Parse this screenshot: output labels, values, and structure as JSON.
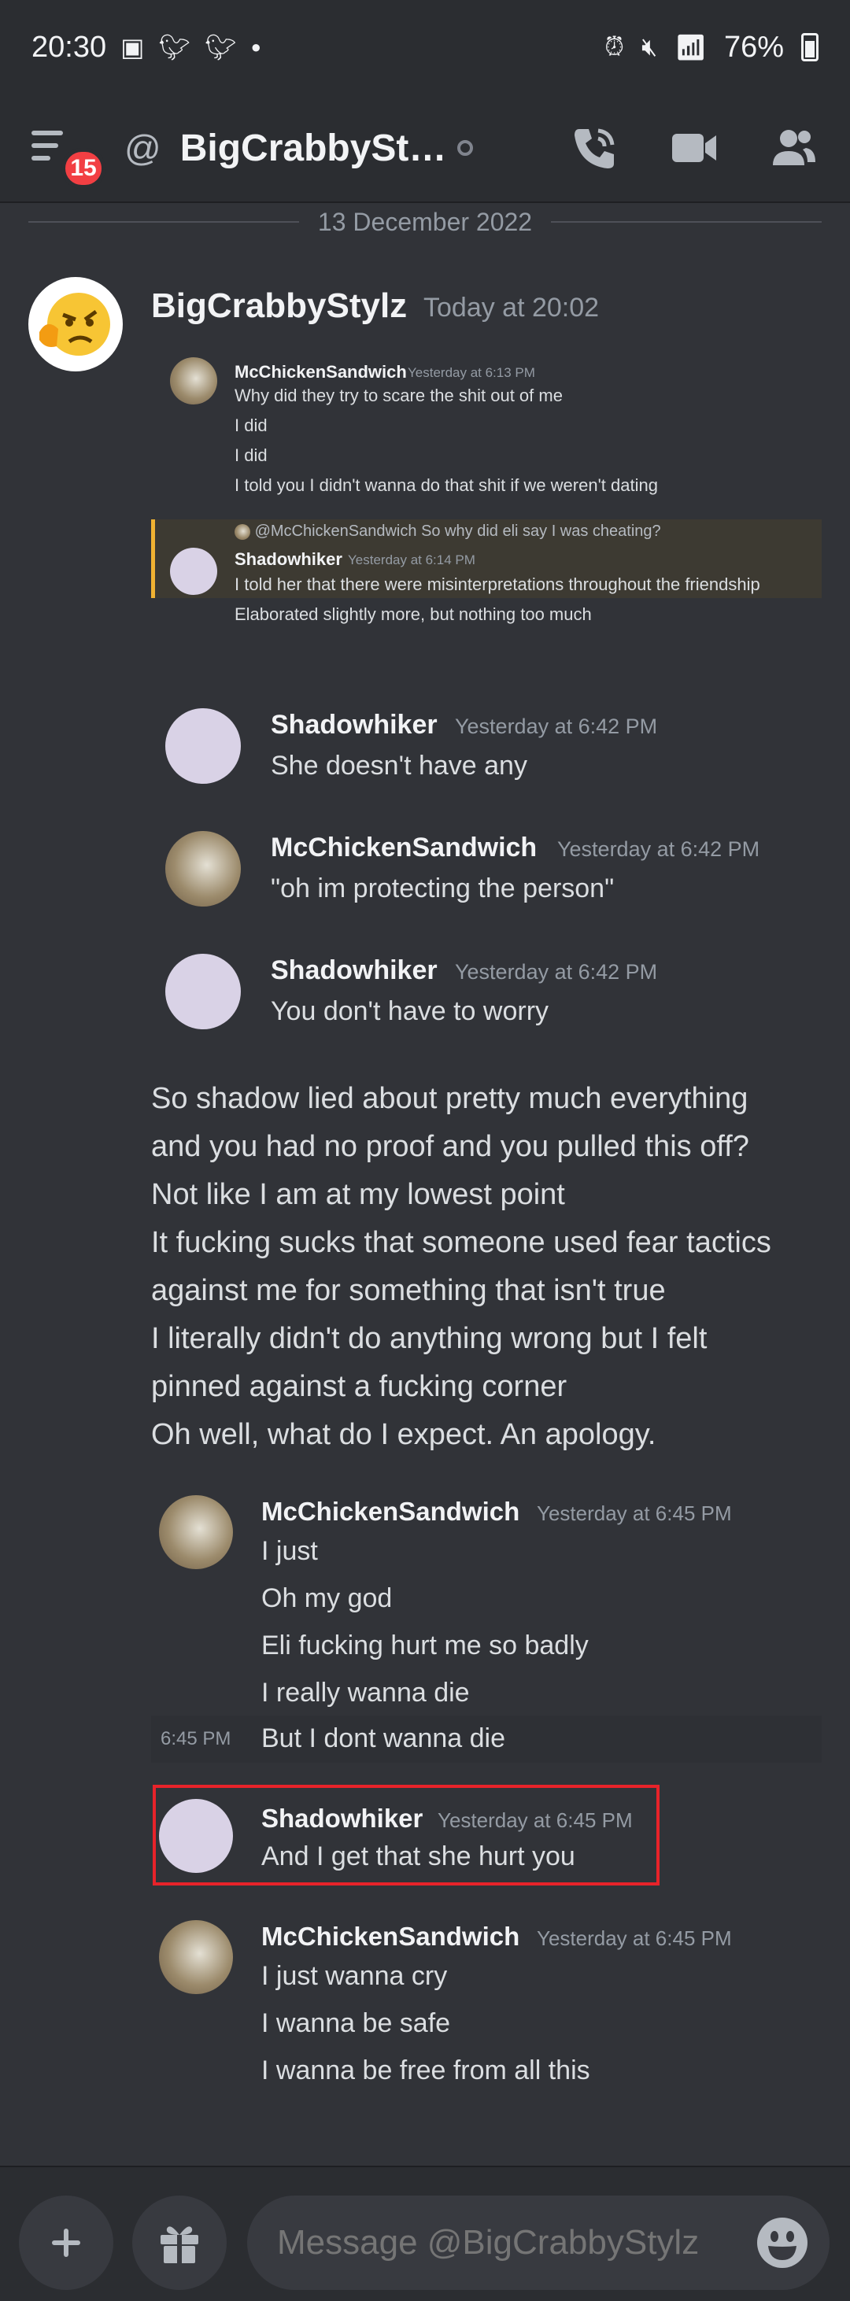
{
  "statusbar": {
    "time": "20:30",
    "battery": "76%"
  },
  "header": {
    "title": "BigCrabbyStylz",
    "title_display": "BigCrabbySt…",
    "badge": "15"
  },
  "divider": {
    "date": "13 December 2022"
  },
  "main_message": {
    "author": "BigCrabbyStylz",
    "timestamp": "Today at 20:02",
    "text_lines": [
      "So shadow lied about pretty much everything",
      "and you had no proof and you pulled this off?",
      "Not like I am at my lowest point",
      "It fucking sucks that someone used fear tactics",
      "against me for something that isn't true",
      "I literally didn't do anything wrong but I felt",
      "pinned against a fucking corner",
      "Oh well, what do I expect. An apology."
    ]
  },
  "embedded": {
    "m1": {
      "author": "McChickenSandwich",
      "timestamp": "Yesterday at 6:13 PM",
      "lines": [
        "Why did they try to scare the shit out of me",
        "I did",
        "I did",
        "I told you I didn't wanna do that shit if we weren't dating"
      ]
    },
    "reply": {
      "reply_to": "@McChickenSandwich",
      "reply_text": "So why did eli say I was cheating?",
      "author": "Shadowhiker",
      "timestamp": "Yesterday at 6:14 PM",
      "lines": [
        "I told her that there were misinterpretations throughout the friendship",
        "Elaborated slightly more, but nothing too much"
      ]
    },
    "m2": {
      "author": "Shadowhiker",
      "timestamp": "Yesterday at 6:42 PM",
      "text": "She doesn't have any"
    },
    "m3": {
      "author": "McChickenSandwich",
      "timestamp": "Yesterday at 6:42 PM",
      "text": "\"oh im protecting the person\""
    },
    "m4": {
      "author": "Shadowhiker",
      "timestamp": "Yesterday at 6:42 PM",
      "text": "You don't have to worry"
    }
  },
  "second_shot": {
    "m1": {
      "author": "McChickenSandwich",
      "timestamp": "Yesterday at 6:45 PM",
      "lines": [
        "I just",
        "Oh my god",
        "Eli fucking hurt me so badly",
        "I really wanna die"
      ],
      "extra_time": "6:45 PM",
      "extra_line": "But I dont wanna die"
    },
    "m2": {
      "author": "Shadowhiker",
      "timestamp": "Yesterday at 6:45 PM",
      "text": "And I get that she hurt you"
    },
    "m3": {
      "author": "McChickenSandwich",
      "timestamp": "Yesterday at 6:45 PM",
      "lines": [
        "I just wanna cry",
        "I wanna be safe",
        "I wanna be free from all this"
      ]
    }
  },
  "input": {
    "placeholder": "Message @BigCrabbyStylz"
  },
  "colors": {
    "accent": "#5865f2",
    "badge": "#f23f43",
    "highlight": "#e8232a",
    "reply_bar": "#f0b232"
  }
}
